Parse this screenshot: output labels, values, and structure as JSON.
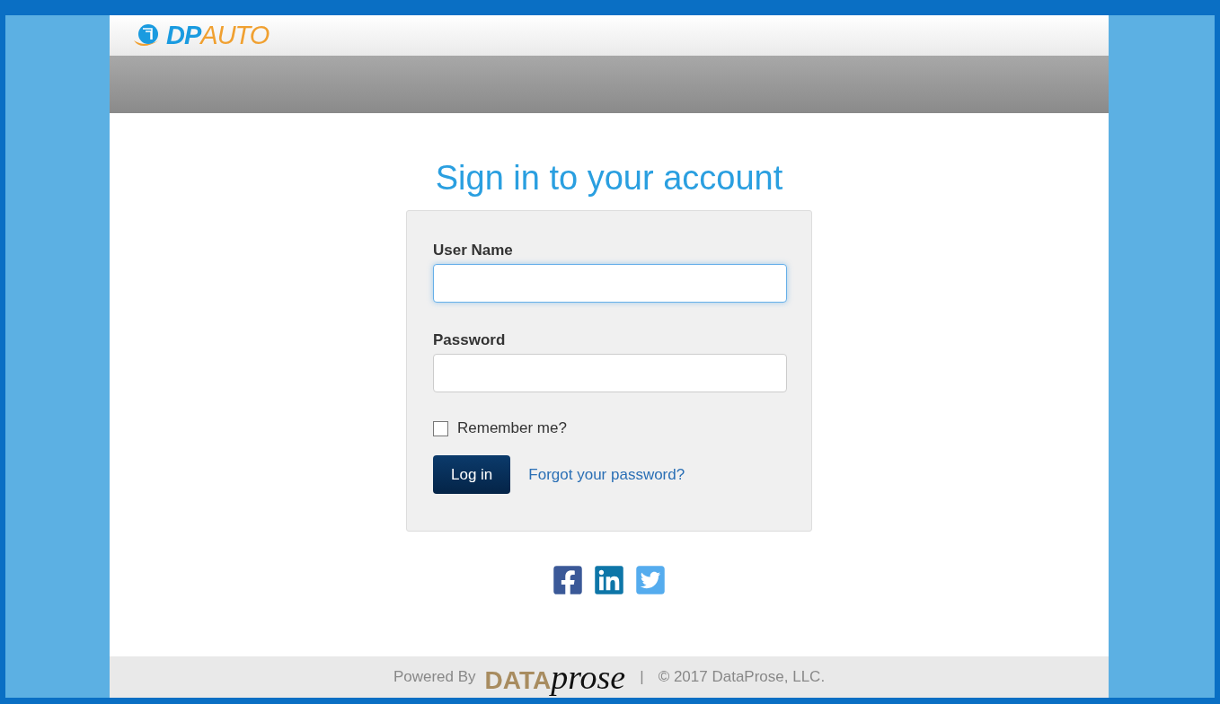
{
  "logo": {
    "part_1": "DP",
    "part_2": "AUTO"
  },
  "title": "Sign in to your account",
  "form": {
    "fields": [
      {
        "label": "User Name",
        "focused": true
      },
      {
        "label": "Password",
        "focused": false
      }
    ],
    "remember": {
      "label": "Remember me?",
      "checked": false
    },
    "button": "Log in",
    "link": "Forgot your password?"
  },
  "footer": {
    "powered": "Powered By",
    "brand_1": "DATA",
    "brand_2": "prose",
    "separator": "|",
    "copyright": "© 2017 DataProse, LLC."
  }
}
